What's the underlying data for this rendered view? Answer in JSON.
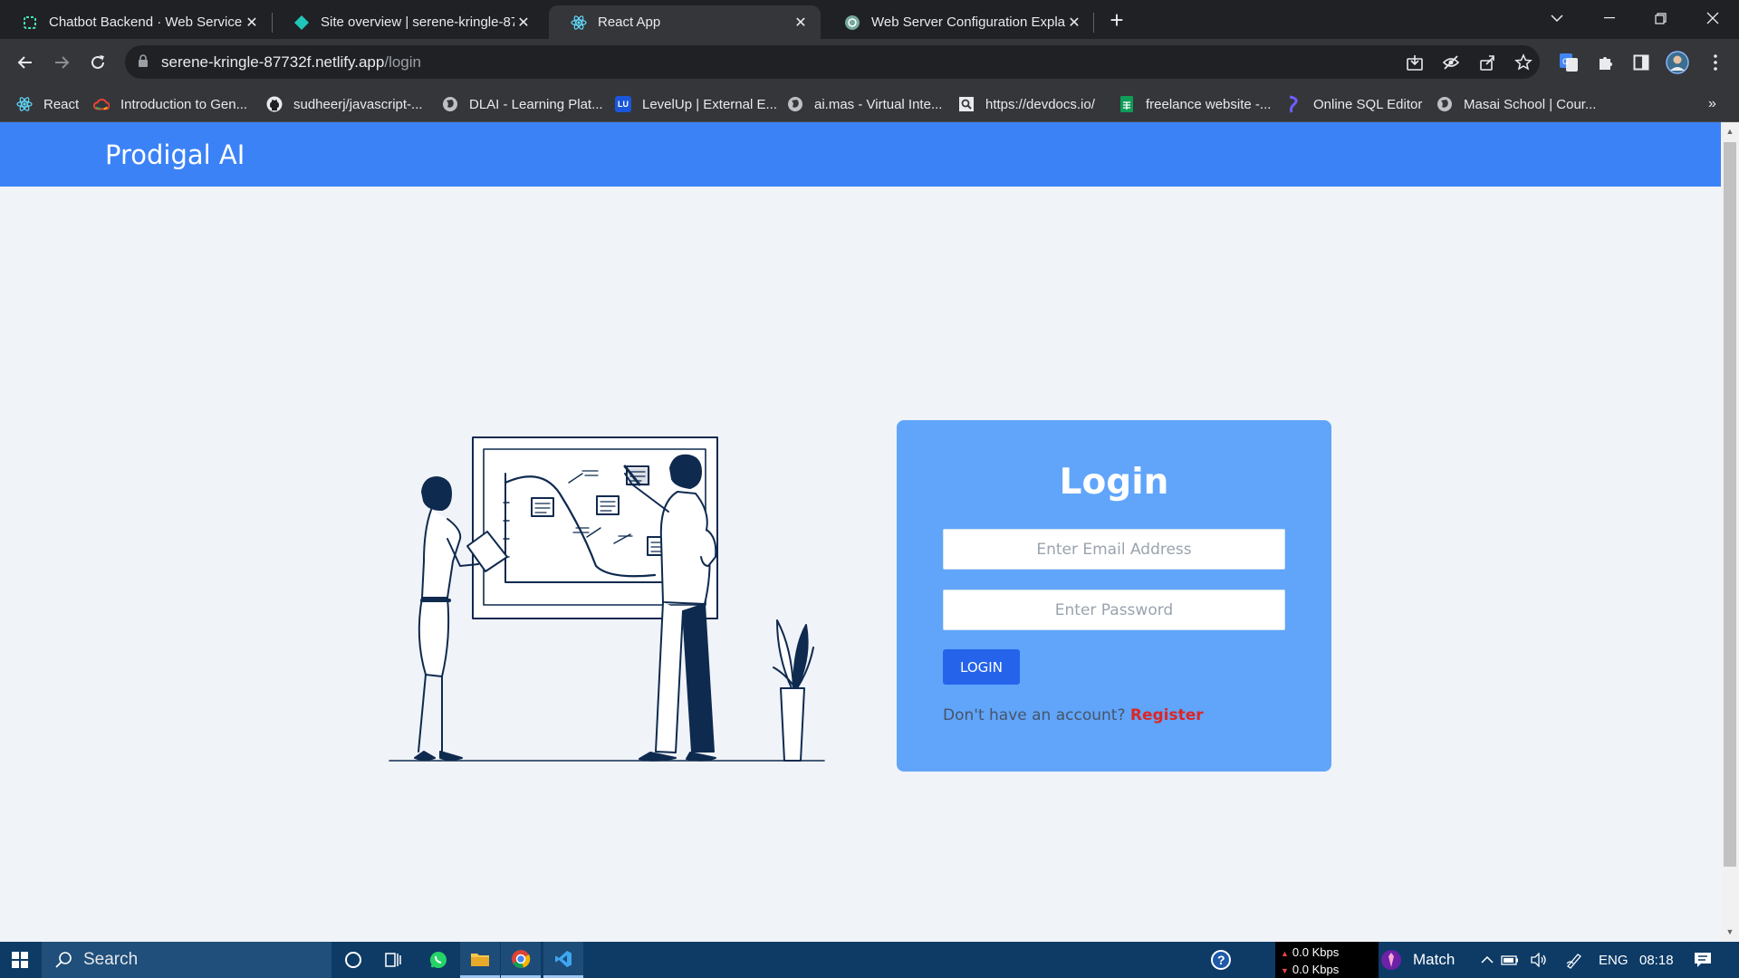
{
  "browser": {
    "tabs": [
      {
        "title": "Chatbot Backend · Web Service",
        "icon": "render-icon",
        "active": false
      },
      {
        "title": "Site overview | serene-kringle-877",
        "icon": "netlify-icon",
        "active": false
      },
      {
        "title": "React App",
        "icon": "react-icon",
        "active": true
      },
      {
        "title": "Web Server Configuration Explan",
        "icon": "chatgpt-icon",
        "active": false
      }
    ],
    "url_host": "serene-kringle-87732f.netlify.app",
    "url_path": "/login",
    "bookmarks": [
      {
        "label": "React",
        "icon": "react-icon"
      },
      {
        "label": "Introduction to Gen...",
        "icon": "google-cloud-icon"
      },
      {
        "label": "sudheerj/javascript-...",
        "icon": "github-icon"
      },
      {
        "label": "DLAI - Learning Plat...",
        "icon": "globe-icon"
      },
      {
        "label": "LevelUp | External E...",
        "icon": "levelup-icon"
      },
      {
        "label": "ai.mas - Virtual Inte...",
        "icon": "globe-icon"
      },
      {
        "label": "https://devdocs.io/",
        "icon": "devdocs-icon"
      },
      {
        "label": "freelance website -...",
        "icon": "sheets-icon"
      },
      {
        "label": "Online SQL Editor",
        "icon": "sql-editor-icon"
      },
      {
        "label": "Masai School | Cour...",
        "icon": "globe-icon"
      }
    ],
    "more_bookmarks": "»",
    "levelup_badge": "LU"
  },
  "page": {
    "brand": "Prodigal AI",
    "login": {
      "heading": "Login",
      "email_placeholder": "Enter Email Address",
      "password_placeholder": "Enter Password",
      "button_label": "LOGIN",
      "no_account_text": "Don't have an account?",
      "register_link": "Register"
    }
  },
  "taskbar": {
    "search_label": "Search",
    "net_up": "0.0 Kbps",
    "net_down": "0.0 Kbps",
    "weather_label": "Match",
    "language": "ENG",
    "time": "08:18"
  },
  "colors": {
    "appbar": "#3b82f6",
    "card": "#60a5fa",
    "login_button": "#2563eb",
    "register_link": "#dc2626",
    "illustration_navy": "#0f2a4f"
  }
}
